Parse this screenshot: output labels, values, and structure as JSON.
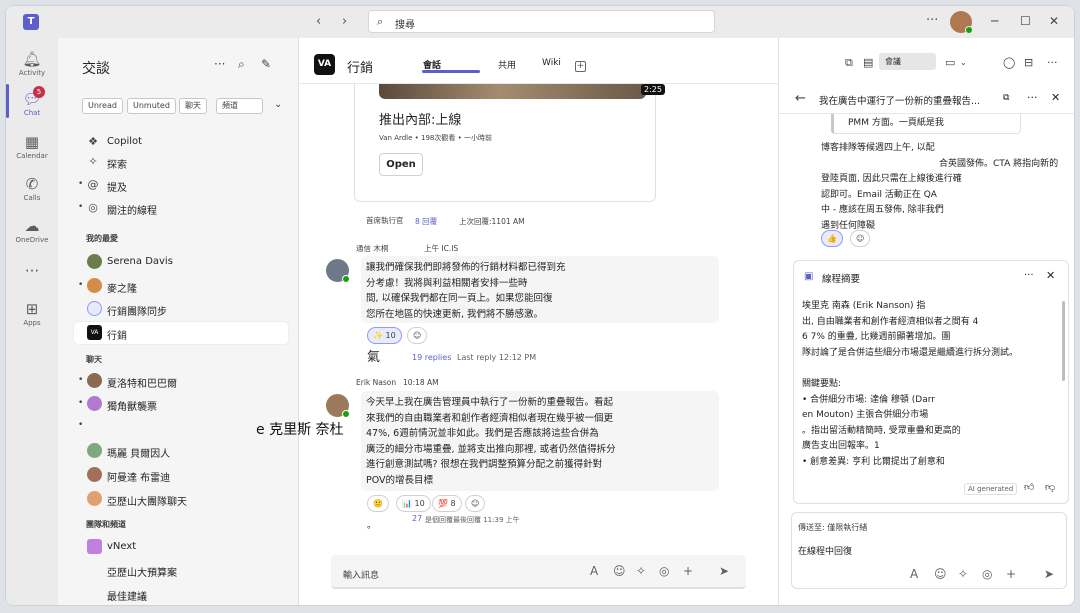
{
  "titlebar": {
    "search_placeholder": "搜尋"
  },
  "rail": {
    "items": [
      {
        "label": "Activity",
        "icon": "bell-icon"
      },
      {
        "label": "Chat",
        "icon": "chat-icon",
        "badge": "5"
      },
      {
        "label": "Calendar",
        "icon": "calendar-icon"
      },
      {
        "label": "Calls",
        "icon": "phone-icon"
      },
      {
        "label": "OneDrive",
        "icon": "cloud-icon"
      },
      {
        "label": "",
        "icon": "more-icon"
      },
      {
        "label": "Apps",
        "icon": "apps-icon"
      }
    ]
  },
  "sidebar": {
    "title": "交談",
    "filters": [
      "Unread",
      "Unmuted",
      "聊天",
      "頻道"
    ],
    "pinned": [
      {
        "label": "Copilot",
        "icon": "copilot-icon"
      },
      {
        "label": "探索",
        "icon": "sparkle-icon"
      },
      {
        "label": "提及",
        "icon": "at-icon"
      },
      {
        "label": "關注的線程",
        "icon": "follow-icon"
      }
    ],
    "favorites_label": "我的最愛",
    "favorites": [
      {
        "label": "Serena Davis",
        "color": "#6b7d4a"
      },
      {
        "label": "麥之隆",
        "color": "#d48d48"
      },
      {
        "label": "行銷團隊同步",
        "color": "#5b5fc7"
      },
      {
        "label": "行銷",
        "color": "#111111"
      }
    ],
    "chats_label": "聊天",
    "chats": [
      {
        "label": "夏洛特和巴巴爾",
        "color": "#8a6a50"
      },
      {
        "label": "獨角獸襲票",
        "color": "#b07ad0"
      },
      {
        "label": "瑪麗 貝爾因人",
        "color": "#7fa87f"
      },
      {
        "label": "阿曼達 布雷迪",
        "color": "#a0705a"
      },
      {
        "label": "亞歷山大團隊聊天",
        "color": "#e0a070"
      }
    ],
    "teams_label": "團隊和頻道",
    "teams": [
      {
        "label": "vNext",
        "color": "#c080e0"
      },
      {
        "label": "亞歷山大預算案"
      },
      {
        "label": "最佳建議"
      }
    ]
  },
  "channel": {
    "name": "行銷",
    "logo": "VA",
    "tabs": [
      "會話",
      "共用",
      "Wiki"
    ],
    "call_label": "會議"
  },
  "card": {
    "duration": "2:25",
    "title": "推出內部:上線",
    "subtitle": "Van Ardle • 198次觀看 • 一小時前",
    "open_label": "Open"
  },
  "card_meta": {
    "author": "首席執行官",
    "replies": "8 回覆",
    "last": "上次回覆:1101 AM"
  },
  "msg1": {
    "author": "通信 木桐",
    "time": "上午 IC.IS",
    "lines": [
      "讓我們確保我們即將發佈的行銷材料都已得到充",
      "分考慮！我將與利益相關者安排一些時",
      "間, 以確保我們都在同一頁上。如果您能回復",
      "您所在地區的快速更新, 我們將不勝感激。"
    ],
    "reaction1": "✨ 10",
    "extra": "氣",
    "replies": "19 replies",
    "last_reply": "Last reply 12:12 PM"
  },
  "msg2": {
    "author": "Erik Nason",
    "time": "10:18 AM",
    "lines": [
      "今天早上我在廣告管理員中執行了一份新的重疊報告。看起",
      "來我們的自由職業者和創作者經濟相似者現在幾乎被一個更",
      "47%, 6週前情況並非如此。我們是否應該將這些合併為",
      "廣泛的細分市場重疊, 並將支出推向那裡, 或者仍然值得拆分",
      "進行創意測試嗎? 很想在我們調整預算分配之前獲得針對",
      "POV的增長目標"
    ],
    "reactions": [
      "🙂",
      "📊 10",
      "💯 8"
    ],
    "replies": "27",
    "last_reply": "是個回覆最後回覆 11:39 上午",
    "trail": "。"
  },
  "floating_text": "e 克里斯 奈杜",
  "compose": {
    "placeholder": "輸入訊息"
  },
  "thread": {
    "title": "我在廣告中運行了一份新的重疊報告...",
    "quote": "PMM 方面。一頁紙是我",
    "lines": [
      "博客排隊等候週四上午, 以配",
      "合英國發佈。CTA 將指向新的",
      "登陸頁面, 因此只需在上線後進行確",
      "認即可。Email 活動正在 QA",
      "中 - 應該在周五發佈, 除非我們",
      "遇到任何障礙"
    ],
    "reaction": "👍"
  },
  "summary": {
    "title": "線程摘要",
    "lines": [
      "埃里克 南森 (Erik Nanson) 指",
      "出, 自由職業者和創作者經濟相似者之間有 4",
      "6 7% 的重疊, 比幾週前顯著增加。團",
      "隊討論了是合併這些細分市場還是繼續進行拆分測試。",
      "",
      "關鍵要點:",
      "  • 合併細分市場: 達倫 穆頓 (Darr",
      "    en Mouton) 主張合併細分市場",
      "    。指出留活動精簡時, 受眾重疊和更高的",
      "    廣告支出回報率。1",
      "  • 創意差異: 亨利 比爾提出了創意和"
    ],
    "ai_label": "AI generated"
  },
  "reply": {
    "to": "傳送至: 僅限執行緒",
    "text": "在線程中回復"
  }
}
